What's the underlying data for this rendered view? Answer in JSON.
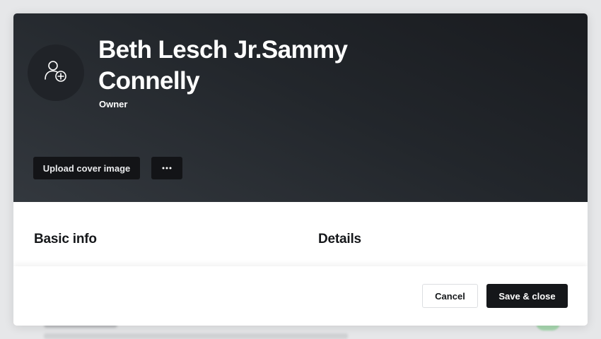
{
  "profile": {
    "name": "Beth Lesch Jr.Sammy Connelly",
    "role": "Owner",
    "avatar_icon": "user-add-icon"
  },
  "cover": {
    "upload_label": "Upload cover image",
    "more_icon": "ellipsis-icon"
  },
  "sections": {
    "basic_info": "Basic info",
    "details": "Details"
  },
  "footer": {
    "cancel_label": "Cancel",
    "save_label": "Save & close"
  },
  "colors": {
    "cover_dark": "#191b1f",
    "cover_light": "#33383e",
    "button_dark": "#15171a",
    "background_green": "#a8d8b0"
  }
}
